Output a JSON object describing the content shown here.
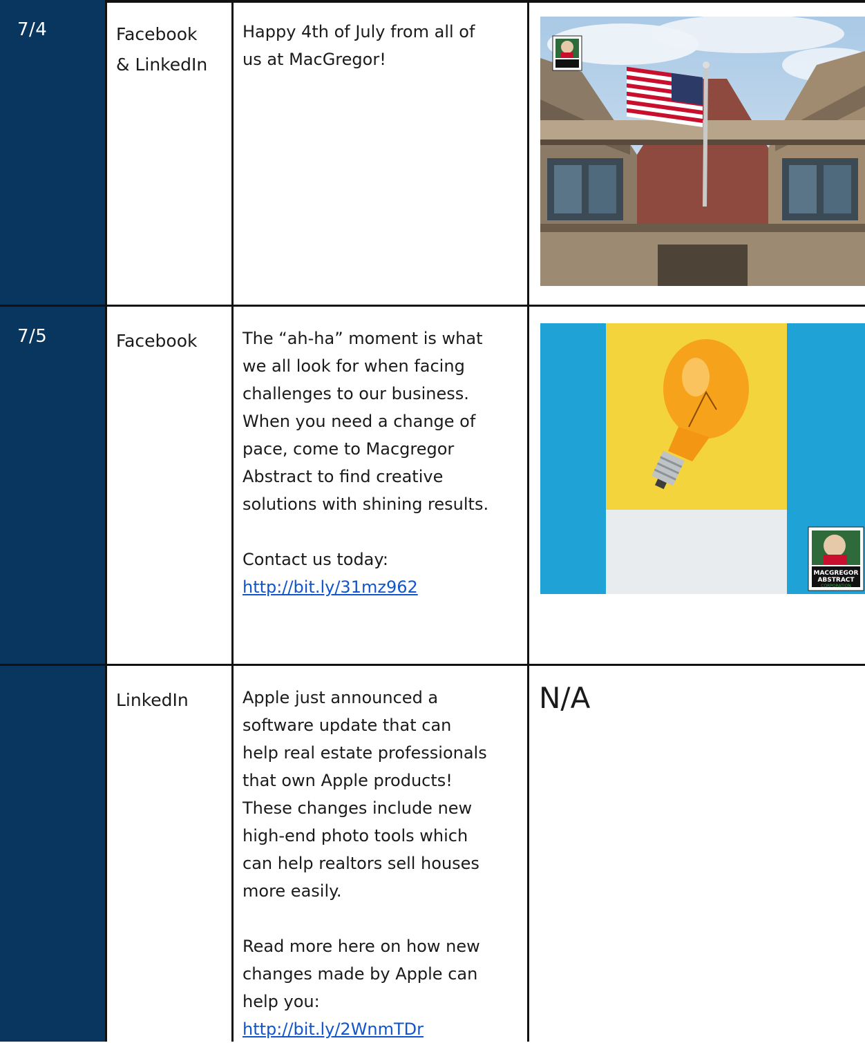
{
  "rows": [
    {
      "date": "7/4",
      "platform": [
        "Facebook",
        "& LinkedIn"
      ],
      "post_paragraphs": [
        "Happy 4th of July from all of",
        "us at MacGregor!"
      ],
      "media": "photo-flag-building"
    },
    {
      "date": "7/5",
      "platform": [
        "Facebook"
      ],
      "post_lines": [
        "The “ah-ha” moment is what",
        "we all look for when facing",
        "challenges to our business.",
        "When you need a change of",
        "pace, come to Macgregor",
        "Abstract to find creative",
        "solutions with shining results."
      ],
      "contact_label": "Contact us today:",
      "link": "http://bit.ly/31mz962",
      "media": "photo-lightbulb"
    },
    {
      "date": "",
      "platform": [
        "LinkedIn"
      ],
      "post_lines": [
        "Apple just announced a",
        "software update that can",
        "help real estate professionals",
        "that own Apple products!",
        "These changes include new",
        "high-end photo tools which",
        "can help realtors sell houses",
        "more easily."
      ],
      "read_more_lines": [
        "Read more here on how new",
        "changes made by Apple can",
        "help you:"
      ],
      "link": "http://bit.ly/2WnmTDr",
      "media_text": "N/A"
    }
  ],
  "logo_text": {
    "line1": "MACGREGOR",
    "line2": "ABSTRACT",
    "line3": "CORPORATION"
  },
  "colors": {
    "date_column": "#08365f",
    "link": "#1155cc",
    "border": "#111111"
  }
}
